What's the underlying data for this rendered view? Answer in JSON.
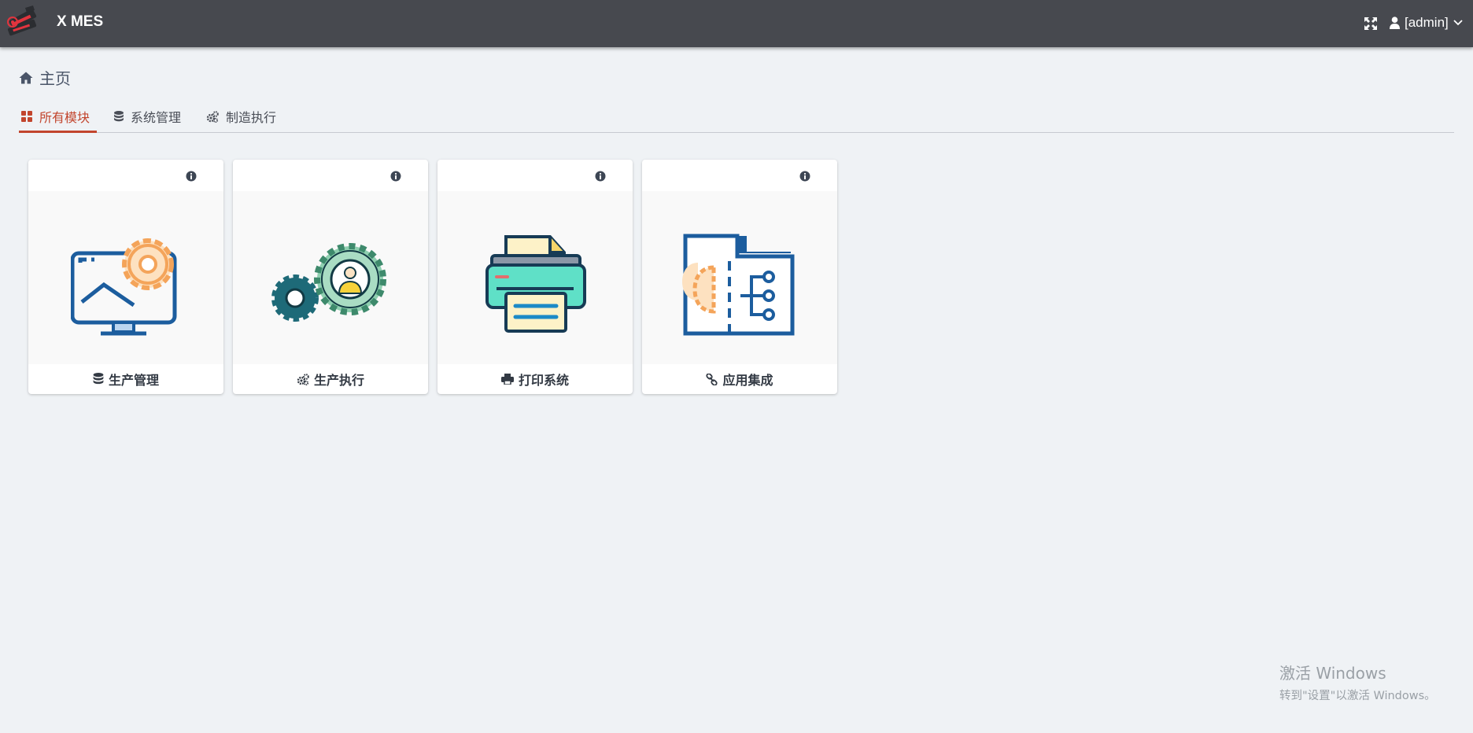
{
  "header": {
    "app_title": "X MES",
    "user_label": "[admin]",
    "bg_color": "#47494f"
  },
  "breadcrumb": {
    "label": "主页",
    "icon": "home-icon"
  },
  "tabs": [
    {
      "label": "所有模块",
      "icon": "grid-icon",
      "active": true
    },
    {
      "label": "系统管理",
      "icon": "database-icon",
      "active": false
    },
    {
      "label": "制造执行",
      "icon": "gears-icon",
      "active": false
    }
  ],
  "modules": [
    {
      "label": "生产管理",
      "icon": "database-icon",
      "image": "monitor-gear-illustration"
    },
    {
      "label": "生产执行",
      "icon": "gears-icon",
      "image": "gears-worker-illustration"
    },
    {
      "label": "打印系统",
      "icon": "print-icon",
      "image": "printer-illustration"
    },
    {
      "label": "应用集成",
      "icon": "link-icon",
      "image": "folder-network-illustration"
    }
  ],
  "watermark": {
    "line1": "激活 Windows",
    "line2": "转到\"设置\"以激活 Windows。"
  },
  "colors": {
    "accent": "#c2452d",
    "page_bg": "#eff2f5",
    "card_bg": "#ffffff"
  }
}
